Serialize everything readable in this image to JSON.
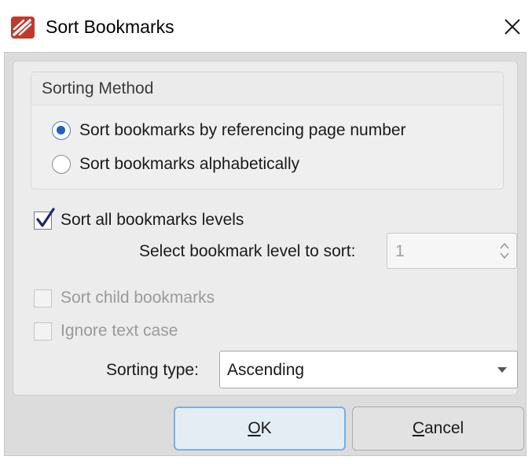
{
  "window": {
    "title": "Sort Bookmarks",
    "icon": "app-logo-icon",
    "close_icon": "close-icon"
  },
  "sorting_method": {
    "title": "Sorting Method",
    "options": [
      {
        "label": "Sort bookmarks by referencing page number",
        "selected": true
      },
      {
        "label": "Sort bookmarks alphabetically",
        "selected": false
      }
    ]
  },
  "sort_all_levels": {
    "label": "Sort all bookmarks levels",
    "checked": true
  },
  "level_select": {
    "label": "Select bookmark level to sort:",
    "value": "1",
    "enabled": false
  },
  "sort_child": {
    "label": "Sort child bookmarks",
    "checked": false,
    "enabled": false
  },
  "ignore_case": {
    "label": "Ignore text case",
    "checked": false,
    "enabled": false
  },
  "sorting_type": {
    "label": "Sorting type:",
    "value": "Ascending"
  },
  "buttons": {
    "ok": {
      "mnemonic": "O",
      "rest": "K"
    },
    "cancel": {
      "mnemonic": "C",
      "rest": "ancel"
    }
  },
  "colors": {
    "accent": "#1f5fbf",
    "logo": "#c0392b",
    "default_button_border": "#7ab0e6"
  }
}
